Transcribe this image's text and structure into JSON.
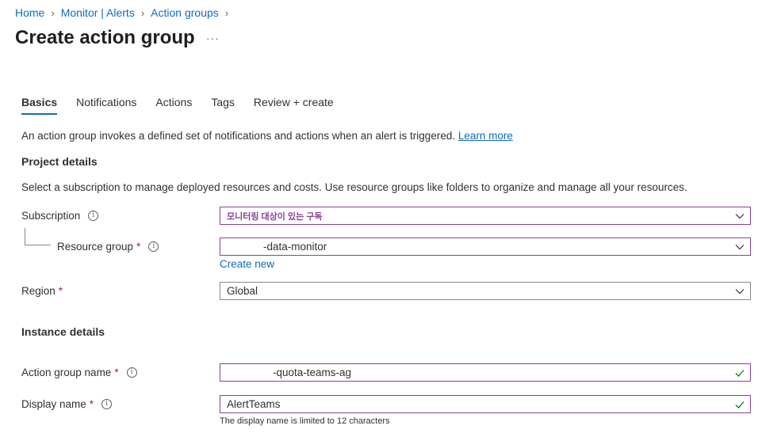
{
  "breadcrumb": {
    "items": [
      "Home",
      "Monitor | Alerts",
      "Action groups"
    ]
  },
  "page": {
    "title": "Create action group",
    "more": "···"
  },
  "tabs": [
    "Basics",
    "Notifications",
    "Actions",
    "Tags",
    "Review + create"
  ],
  "intro": {
    "text": "An action group invokes a defined set of notifications and actions when an alert is triggered.",
    "learn_more": "Learn more"
  },
  "project": {
    "heading": "Project details",
    "description": "Select a subscription to manage deployed resources and costs. Use resource groups like folders to organize and manage all your resources.",
    "subscription": {
      "label": "Subscription",
      "value": "모니터링 대상이 있는 구독"
    },
    "resource_group": {
      "label": "Resource group",
      "required": "*",
      "value": "-data-monitor",
      "create_new": "Create new"
    },
    "region": {
      "label": "Region",
      "required": "*",
      "value": "Global"
    }
  },
  "instance": {
    "heading": "Instance details",
    "action_group_name": {
      "label": "Action group name",
      "required": "*",
      "value": "-quota-teams-ag"
    },
    "display_name": {
      "label": "Display name",
      "required": "*",
      "value": "AlertTeams",
      "hint": "The display name is limited to 12 characters"
    }
  },
  "icons": {
    "info": "info-icon",
    "chevron": "chevron-down-icon",
    "check": "checkmark-icon",
    "breadcrumb_sep": "chevron-right-icon"
  },
  "colors": {
    "accent": "#0f6cbd",
    "focus_border": "#8b3f99",
    "valid": "#107c10",
    "required": "#a4262c"
  }
}
